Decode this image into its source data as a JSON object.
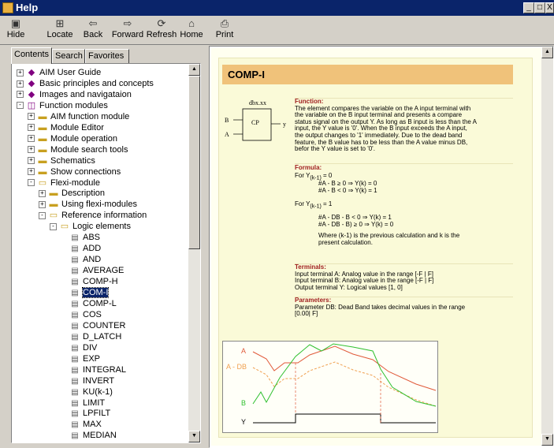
{
  "window": {
    "title": "Help"
  },
  "window_buttons": {
    "minimize": "_",
    "maximize": "□",
    "close": "X"
  },
  "toolbar": [
    {
      "label": "Hide",
      "icon": "hide-icon",
      "glyph": "▣"
    },
    {
      "label": "Locate",
      "icon": "locate-icon",
      "glyph": "⊞"
    },
    {
      "label": "Back",
      "icon": "back-arrow-icon",
      "glyph": "⇦"
    },
    {
      "label": "Forward",
      "icon": "forward-arrow-icon",
      "glyph": "⇨"
    },
    {
      "label": "Refresh",
      "icon": "refresh-icon",
      "glyph": "⟳"
    },
    {
      "label": "Home",
      "icon": "home-icon",
      "glyph": "⌂"
    },
    {
      "label": "Print",
      "icon": "print-icon",
      "glyph": "⎙"
    }
  ],
  "tabs": [
    {
      "label": "Contents"
    },
    {
      "label": "Search"
    },
    {
      "label": "Favorites"
    }
  ],
  "tree": [
    {
      "label": "AIM User Guide",
      "level": 0,
      "toggle": "+",
      "icon": "book"
    },
    {
      "label": "Basic principles and concepts",
      "level": 0,
      "toggle": "+",
      "icon": "book"
    },
    {
      "label": "Images and navigataion",
      "level": 0,
      "toggle": "+",
      "icon": "book"
    },
    {
      "label": "Function modules",
      "level": 0,
      "toggle": "-",
      "icon": "open-book"
    },
    {
      "label": "AIM function module",
      "level": 1,
      "toggle": "+",
      "icon": "folder"
    },
    {
      "label": "Module Editor",
      "level": 1,
      "toggle": "+",
      "icon": "folder"
    },
    {
      "label": "Module operation",
      "level": 1,
      "toggle": "+",
      "icon": "folder"
    },
    {
      "label": "Module search tools",
      "level": 1,
      "toggle": "+",
      "icon": "folder"
    },
    {
      "label": "Schematics",
      "level": 1,
      "toggle": "+",
      "icon": "folder"
    },
    {
      "label": "Show connections",
      "level": 1,
      "toggle": "+",
      "icon": "folder"
    },
    {
      "label": "Flexi-module",
      "level": 1,
      "toggle": "-",
      "icon": "open-folder"
    },
    {
      "label": "Description",
      "level": 2,
      "toggle": "+",
      "icon": "folder"
    },
    {
      "label": "Using flexi-modules",
      "level": 2,
      "toggle": "+",
      "icon": "folder"
    },
    {
      "label": "Reference information",
      "level": 2,
      "toggle": "-",
      "icon": "open-folder"
    },
    {
      "label": "Logic elements",
      "level": 3,
      "toggle": "-",
      "icon": "open-folder"
    },
    {
      "label": "ABS",
      "level": 4,
      "icon": "page"
    },
    {
      "label": "ADD",
      "level": 4,
      "icon": "page"
    },
    {
      "label": "AND",
      "level": 4,
      "icon": "page"
    },
    {
      "label": "AVERAGE",
      "level": 4,
      "icon": "page"
    },
    {
      "label": "COMP-H",
      "level": 4,
      "icon": "page"
    },
    {
      "label": "COM-I",
      "level": 4,
      "icon": "page",
      "selected": true
    },
    {
      "label": "COMP-L",
      "level": 4,
      "icon": "page"
    },
    {
      "label": "COS",
      "level": 4,
      "icon": "page"
    },
    {
      "label": "COUNTER",
      "level": 4,
      "icon": "page"
    },
    {
      "label": "D_LATCH",
      "level": 4,
      "icon": "page"
    },
    {
      "label": "DIV",
      "level": 4,
      "icon": "page"
    },
    {
      "label": "EXP",
      "level": 4,
      "icon": "page"
    },
    {
      "label": "INTEGRAL",
      "level": 4,
      "icon": "page"
    },
    {
      "label": "INVERT",
      "level": 4,
      "icon": "page"
    },
    {
      "label": "KU(k-1)",
      "level": 4,
      "icon": "page"
    },
    {
      "label": "LIMIT",
      "level": 4,
      "icon": "page"
    },
    {
      "label": "LPFILT",
      "level": 4,
      "icon": "page"
    },
    {
      "label": "MAX",
      "level": 4,
      "icon": "page"
    },
    {
      "label": "MEDIAN",
      "level": 4,
      "icon": "page"
    }
  ],
  "content": {
    "heading": "COMP-I",
    "diagram": {
      "id": "dbx.xx",
      "block": "CP",
      "in_b": "B",
      "in_a": "A",
      "out": "y"
    },
    "function": {
      "title": "Function:",
      "lines": [
        "The element compares the variable on the A input terminal with",
        "the variable on the B input terminal and presents a compare",
        "status signal on the output Y. As long as B input is less than the A",
        "input, the Y value is '0'. When the B input exceeds the A input,",
        "the output changes to '1' immediately. Due to the dead band",
        "feature, the B value has to be less than the A value minus DB,",
        "befor the Y value is set to '0'."
      ]
    },
    "formula": {
      "title": "Formula:",
      "for0_pre": "For Y",
      "for0_sub": "(k-1)",
      "for0_post": " = 0",
      "f1": "#A - B ≥ 0 ⇒ Y(k) = 0",
      "f2": "#A - B < 0 ⇒ Y(k) = 1",
      "for1_pre": "For Y",
      "for1_sub": "(k-1)",
      "for1_post": " = 1",
      "f3": "#A - DB - B < 0 ⇒ Y(k) = 1",
      "f4": "#A - DB - B) ≥ 0 ⇒ Y(k) = 0",
      "note1": "Where (k-1) is the previous calculation and k is the",
      "note2": "present calculation."
    },
    "terminals": {
      "title": "Terminals:",
      "lines": [
        "Input terminal A: Analog value in the range [-F | F]",
        "Input terminal B: Analog value in the range [-F | F]",
        "Output terminal Y: Logical values  [1, 0]"
      ]
    },
    "parameters": {
      "title": "Parameters:",
      "lines": [
        "Parameter DB: Dead Band takes decimal values in the range",
        "[0.00| F]"
      ]
    },
    "graph": {
      "label_a": "A",
      "label_adb": "A - DB",
      "label_b": "B",
      "label_y": "Y"
    }
  },
  "colors": {
    "titlebar": "#0a246a",
    "heading_band": "#f0c27a",
    "section_title": "#a02020",
    "line_a": "#e05a3a",
    "line_adb": "#f0a050",
    "line_b": "#30c030"
  }
}
